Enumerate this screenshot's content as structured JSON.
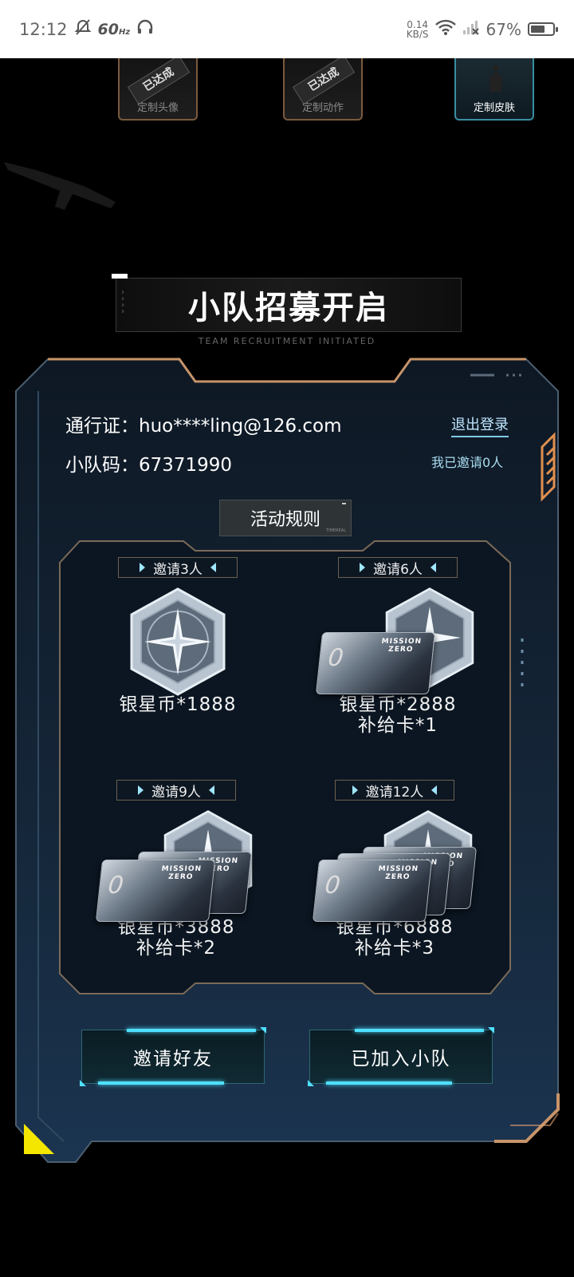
{
  "status_bar": {
    "time": "12:12",
    "refresh_rate": "60",
    "refresh_unit": "Hz",
    "net_speed_value": "0.14",
    "net_speed_unit": "KB/S",
    "battery": "67%",
    "battery_level": 0.67
  },
  "top_rewards": [
    {
      "label": "定制头像",
      "badge": "已达成"
    },
    {
      "label": "定制动作",
      "badge": "已达成"
    },
    {
      "label": "定制皮肤",
      "badge": ""
    }
  ],
  "title": {
    "main": "小队招募开启",
    "sub": "TEAM RECRUITMENT INITIATED"
  },
  "account": {
    "pass_label": "通行证：",
    "pass_value": "huo****ling@126.com",
    "logout": "退出登录",
    "team_code_label": "小队码：",
    "team_code_value": "67371990",
    "invited": "我已邀请0人"
  },
  "rules_button": "活动规则",
  "tiers": [
    {
      "head": "邀请3人",
      "reward_line1": "银星币*1888",
      "reward_line2": ""
    },
    {
      "head": "邀请6人",
      "reward_line1": "银星币*2888",
      "reward_line2": "补给卡*1"
    },
    {
      "head": "邀请9人",
      "reward_line1": "银星币*3888",
      "reward_line2": "补给卡*2"
    },
    {
      "head": "邀请12人",
      "reward_line1": "银星币*6888",
      "reward_line2": "补给卡*3"
    }
  ],
  "card_text": "MISSION ZERO",
  "buttons": {
    "invite": "邀请好友",
    "joined": "已加入小队"
  },
  "colors": {
    "accent_cyan": "#4fe0ff",
    "frame_gold": "#c8946a",
    "panel_bg": "#0f1d2b"
  }
}
